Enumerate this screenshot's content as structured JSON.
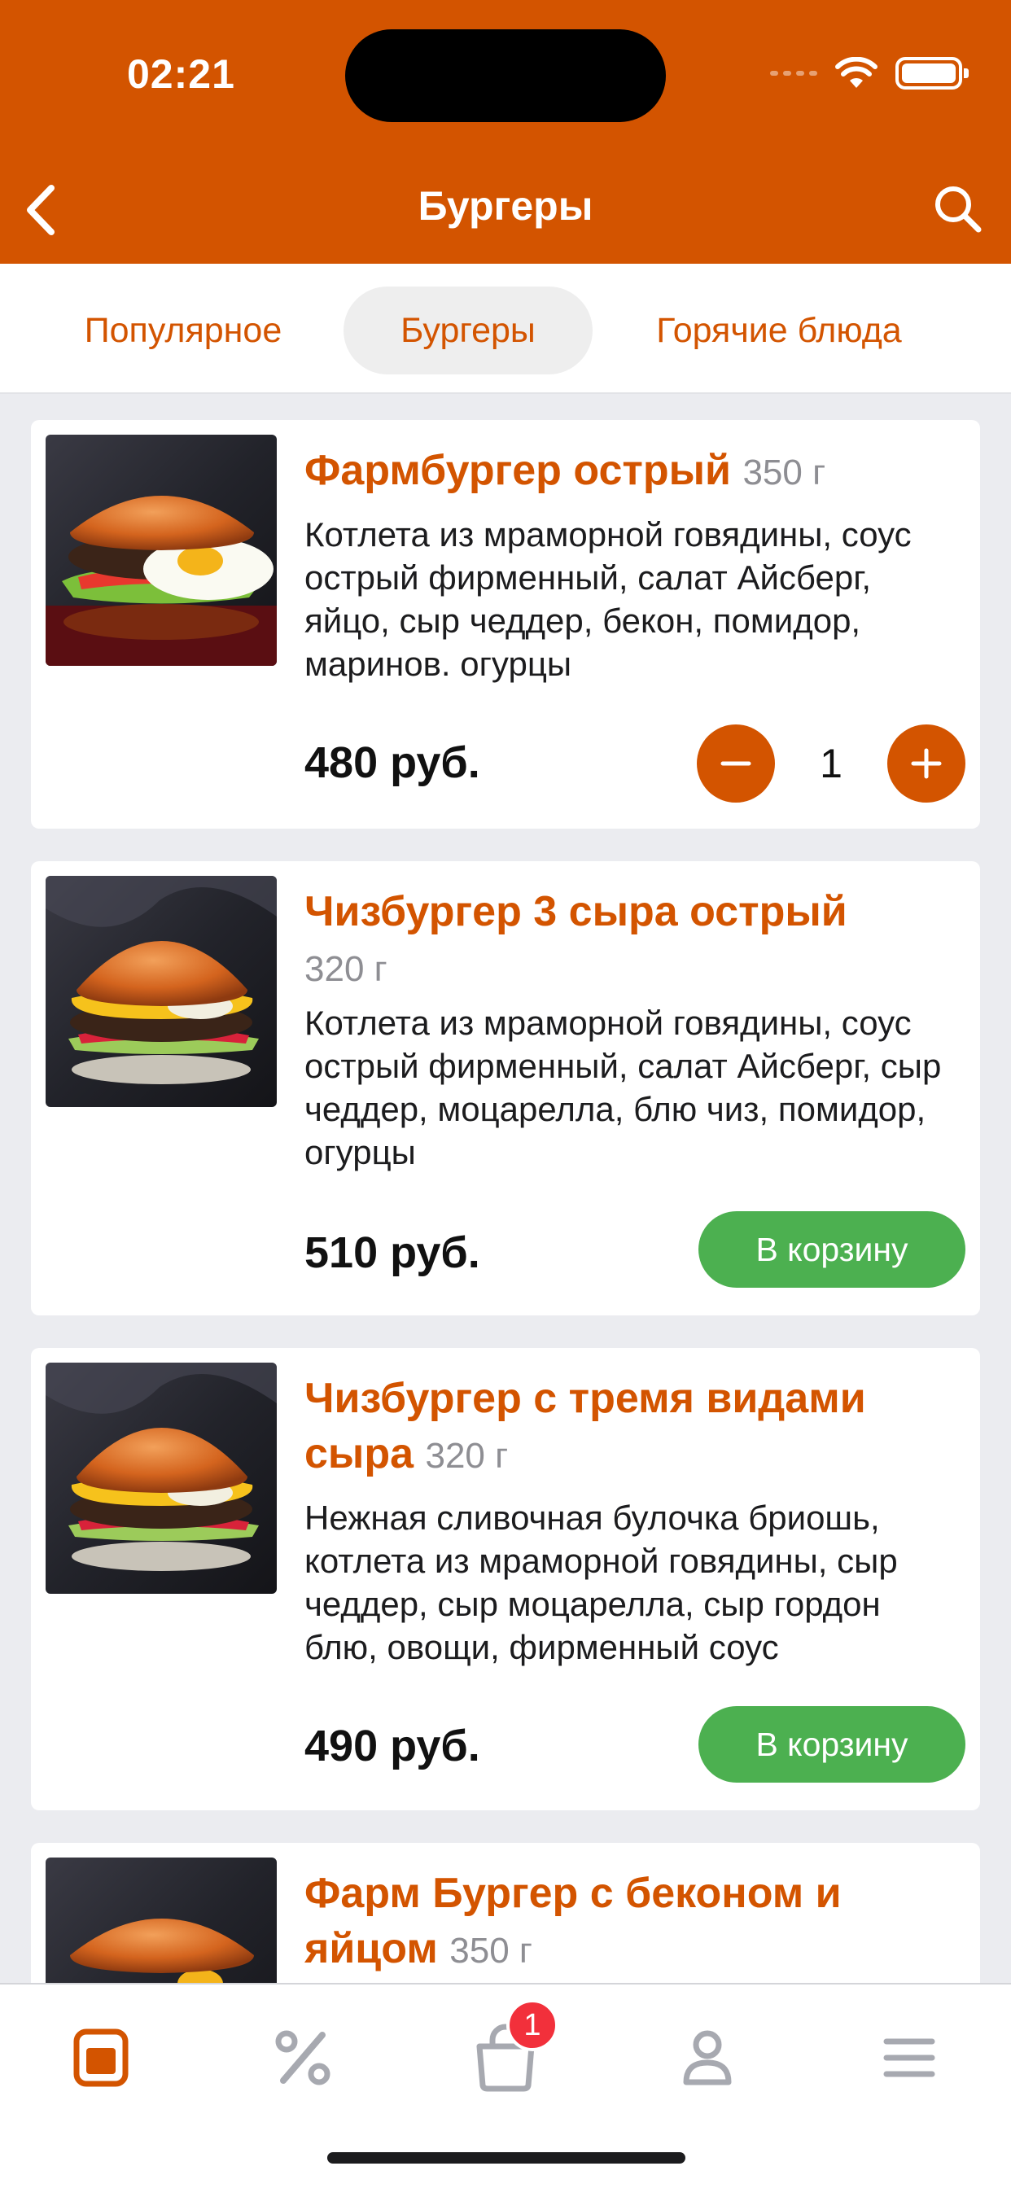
{
  "status_bar": {
    "time": "02:21"
  },
  "header": {
    "title": "Бургеры"
  },
  "tabs": [
    {
      "label": "Популярное",
      "active": false
    },
    {
      "label": "Бургеры",
      "active": true
    },
    {
      "label": "Горячие блюда",
      "active": false
    }
  ],
  "products": [
    {
      "name": "Фармбургер острый",
      "weight": "350 г",
      "description": "Котлета из мраморной говядины, соус острый фирменный, салат Айсберг, яйцо, сыр чеддер, бекон, помидор, маринов. огурцы",
      "price": "480 руб.",
      "quantity": "1",
      "in_cart": true
    },
    {
      "name": "Чизбургер 3 сыра острый",
      "weight": "320 г",
      "description": "Котлета из мраморной говядины, соус острый фирменный, салат Айсберг, сыр чеддер, моцарелла, блю чиз, помидор, огурцы",
      "price": "510 руб.",
      "cart_label": "В корзину",
      "in_cart": false
    },
    {
      "name": "Чизбургер с тремя видами сыра",
      "weight": "320 г",
      "description": "Нежная сливочная булочка бриошь, котлета из мраморной говядины, сыр чеддер, сыр моцарелла, сыр гордон блю, овощи, фирменный соус",
      "price": "490 руб.",
      "cart_label": "В корзину",
      "in_cart": false
    },
    {
      "name": "Фарм Бургер с беконом и яйцом",
      "weight": "350 г"
    }
  ],
  "tabbar": {
    "items": [
      "menu-icon",
      "percent-icon",
      "cart-icon",
      "profile-icon",
      "more-icon"
    ],
    "cart_badge": "1"
  },
  "colors": {
    "brand": "#D35400",
    "cart_button": "#4CB050",
    "badge": "#F2303B"
  }
}
